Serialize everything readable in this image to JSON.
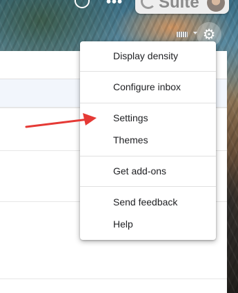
{
  "topbar": {
    "help_icon": "help-circle-icon",
    "apps_icon": "apps-grid-icon",
    "apps_glyph": "•••",
    "account": {
      "brand_label": "Suite",
      "avatar": "user-avatar"
    }
  },
  "toolbar": {
    "keyboard_icon": "keyboard-icon",
    "settings_icon": "gear-icon",
    "settings_glyph": "⚙"
  },
  "settings_menu": {
    "items": [
      {
        "label": "Display density"
      },
      {
        "label": "Configure inbox"
      },
      {
        "label": "Settings"
      },
      {
        "label": "Themes"
      },
      {
        "label": "Get add-ons"
      },
      {
        "label": "Send feedback"
      },
      {
        "label": "Help"
      }
    ]
  },
  "annotation": {
    "arrow_color": "#e53935",
    "points_to": "Settings"
  }
}
